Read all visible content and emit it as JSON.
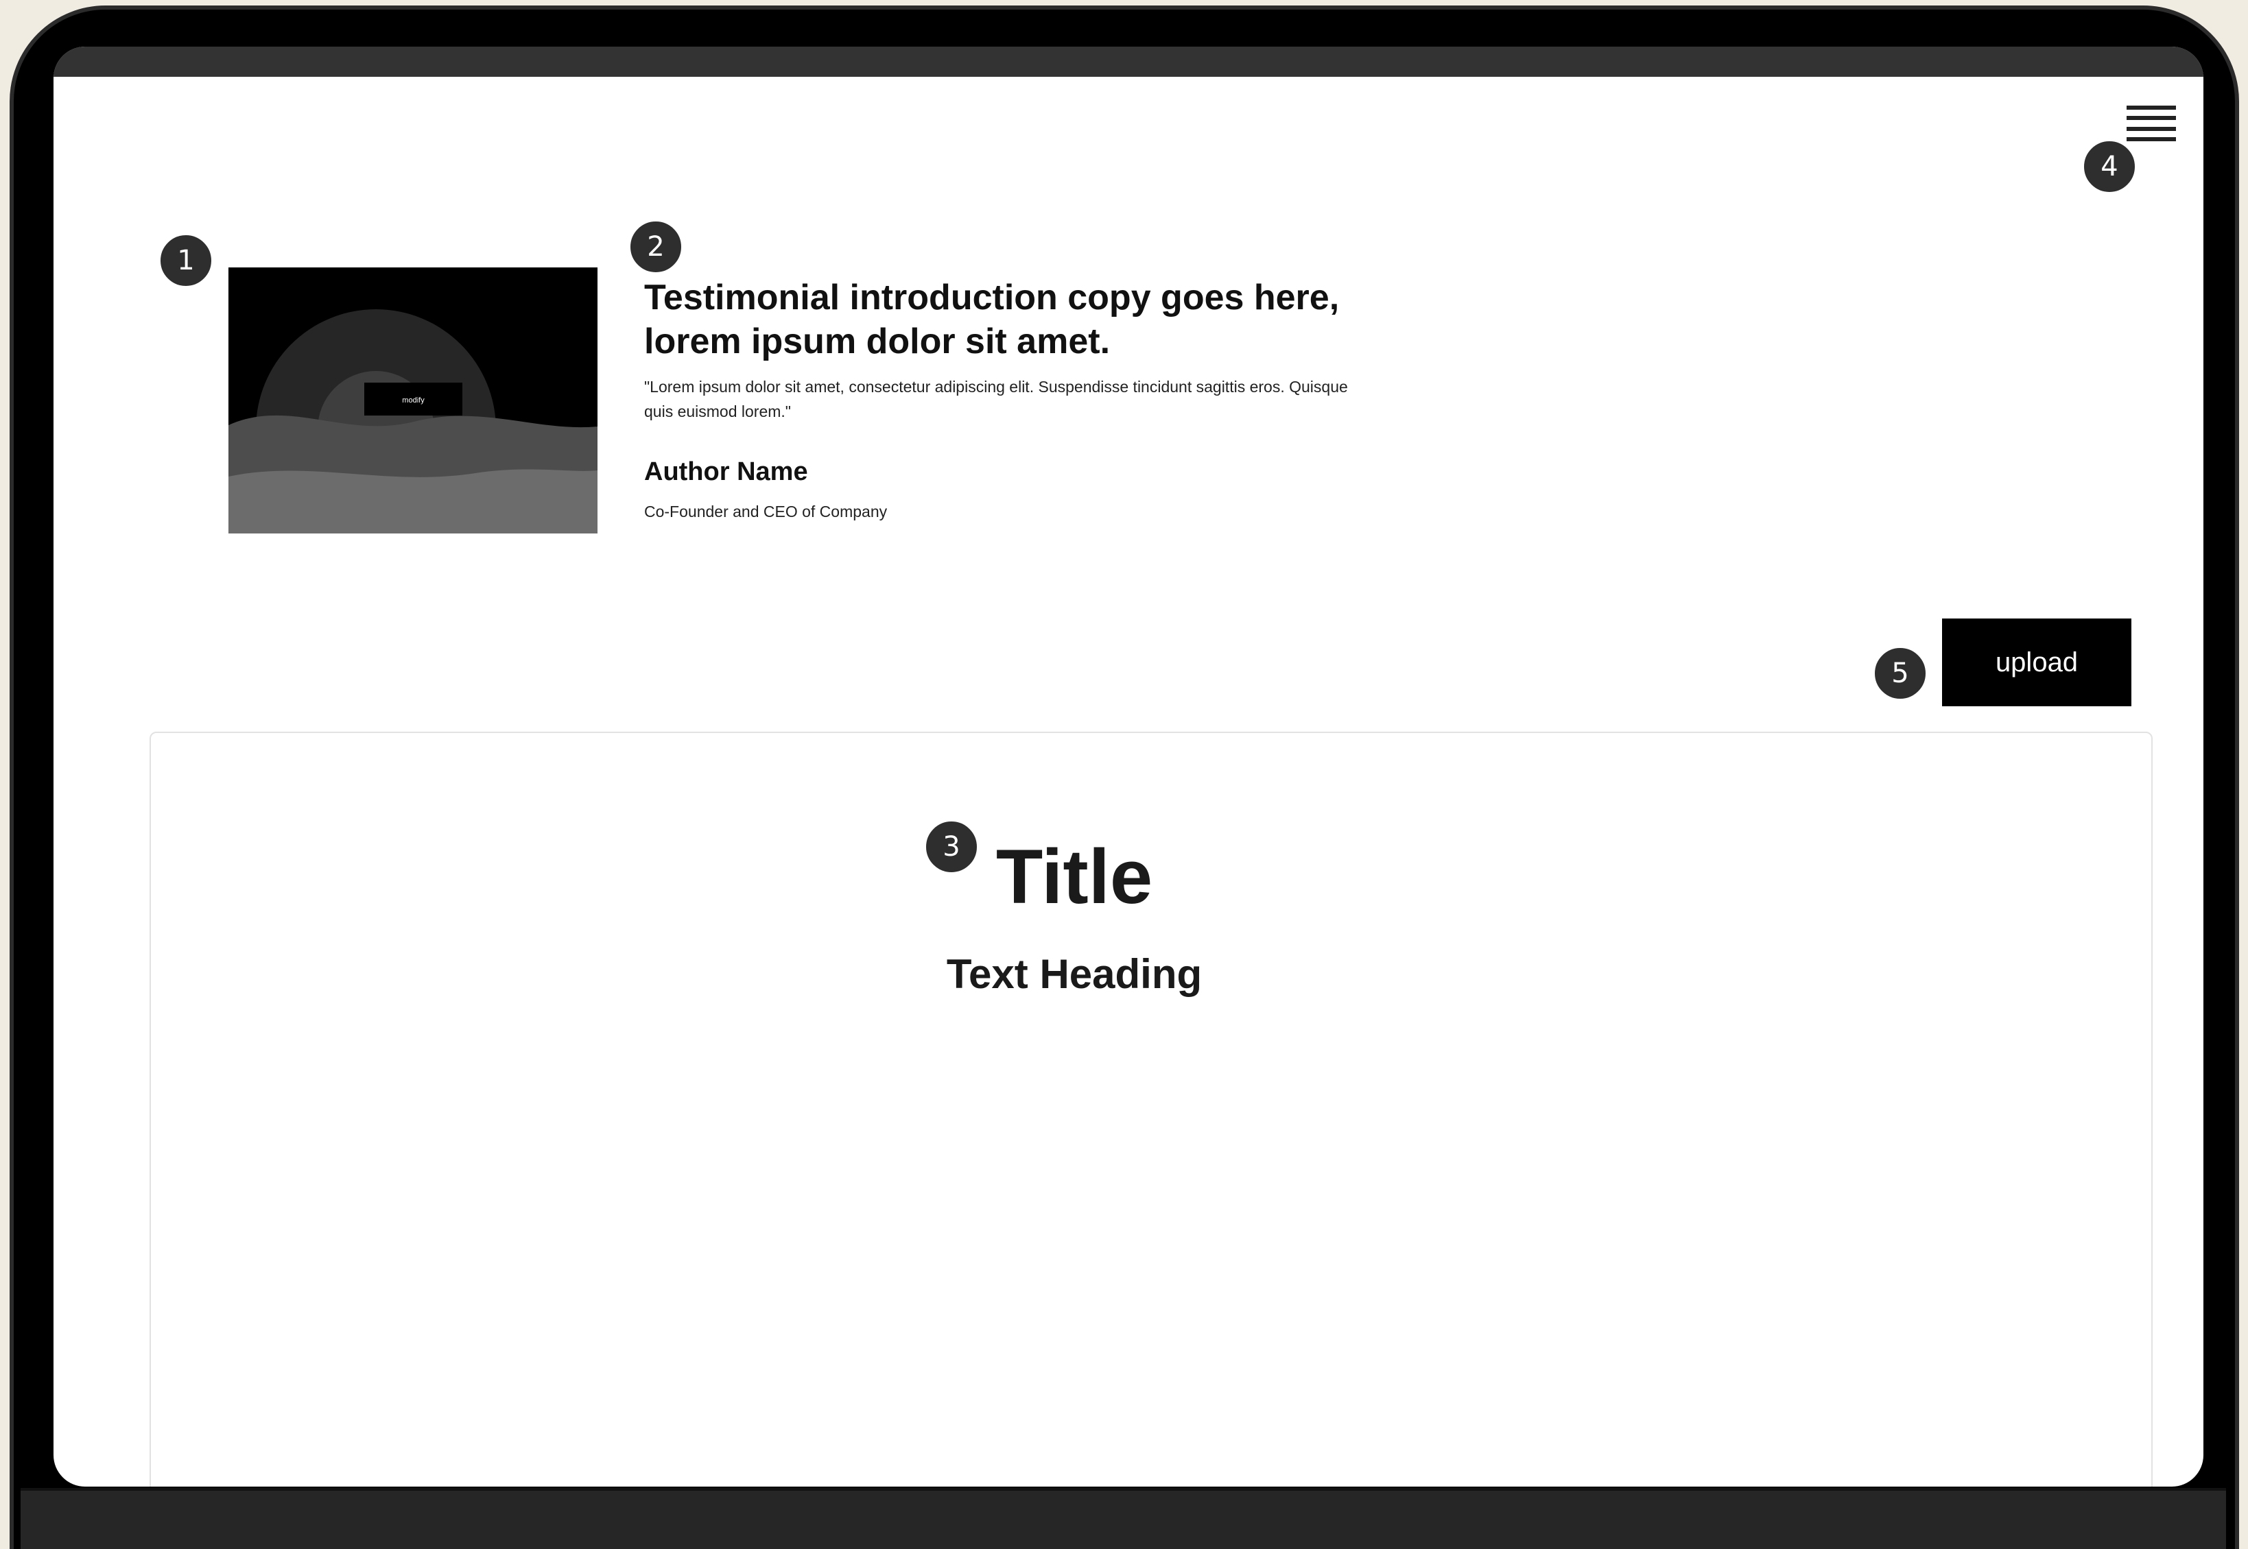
{
  "header": {
    "menu_icon": "hamburger-menu-icon"
  },
  "annotations": {
    "marker_1": "1",
    "marker_2": "2",
    "marker_3": "3",
    "marker_4": "4",
    "marker_5": "5"
  },
  "testimonial": {
    "image_icon": "image-placeholder-icon",
    "image_button_label": "modify",
    "headline": "Testimonial introduction copy goes here, lorem ipsum dolor sit amet.",
    "quote": "\"Lorem ipsum dolor sit amet, consectetur adipiscing elit. Suspendisse tincidunt sagittis eros. Quisque quis euismod lorem.\"",
    "author_name": "Author Name",
    "author_title": "Co-Founder and CEO of Company"
  },
  "toolbar": {
    "upload_label": "upload"
  },
  "panel": {
    "title": "Title",
    "heading": "Text Heading"
  },
  "colors": {
    "accent": "#000000",
    "marker": "#2e2e2e",
    "page_background": "#f1ece2"
  }
}
